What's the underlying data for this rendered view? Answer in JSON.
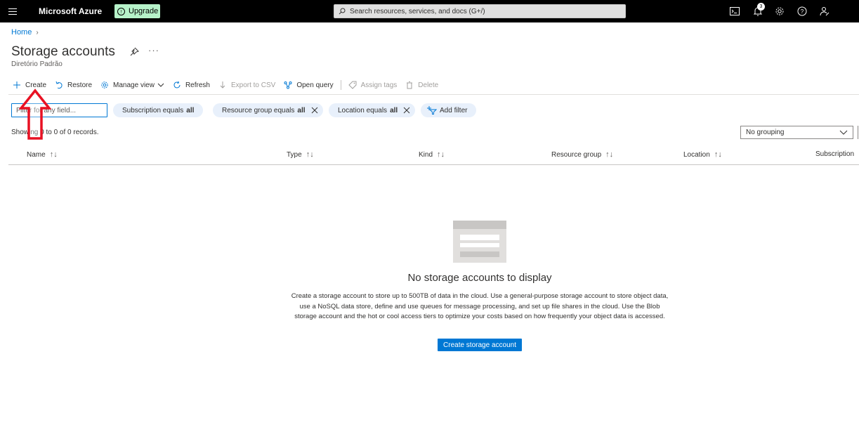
{
  "topbar": {
    "brand": "Microsoft Azure",
    "upgrade_label": "Upgrade",
    "search_placeholder": "Search resources, services, and docs (G+/)",
    "notifications_count": "3"
  },
  "breadcrumb": {
    "home": "Home"
  },
  "page": {
    "title": "Storage accounts",
    "subtitle": "Diretório Padrão",
    "more": "···"
  },
  "toolbar": {
    "create": "Create",
    "restore": "Restore",
    "manage_view": "Manage view",
    "refresh": "Refresh",
    "export_csv": "Export to CSV",
    "open_query": "Open query",
    "assign_tags": "Assign tags",
    "delete": "Delete"
  },
  "filters": {
    "input_placeholder": "Filter for any field...",
    "pills": [
      {
        "text": "Subscription equals",
        "value": "all"
      },
      {
        "text": "Resource group equals",
        "value": "all"
      },
      {
        "text": "Location equals",
        "value": "all"
      }
    ],
    "add_filter": "Add filter"
  },
  "records": "Showing 0 to 0 of 0 records.",
  "grouping": {
    "selected": "No grouping"
  },
  "table": {
    "columns": [
      "Name",
      "Type",
      "Kind",
      "Resource group",
      "Location",
      "Subscription"
    ]
  },
  "empty_state": {
    "title": "No storage accounts to display",
    "description": "Create a storage account to store up to 500TB of data in the cloud. Use a general-purpose storage account to store object data, use a NoSQL data store, define and use queues for message processing, and set up file shares in the cloud. Use the Blob storage account and the hot or cool access tiers to optimize your costs based on how frequently your object data is accessed.",
    "button": "Create storage account"
  },
  "colors": {
    "accent": "#0078d4",
    "topbar": "#000000",
    "upgrade": "#b6f2c9",
    "pill": "#e8f0fb",
    "annotation_arrow": "#e81123"
  }
}
